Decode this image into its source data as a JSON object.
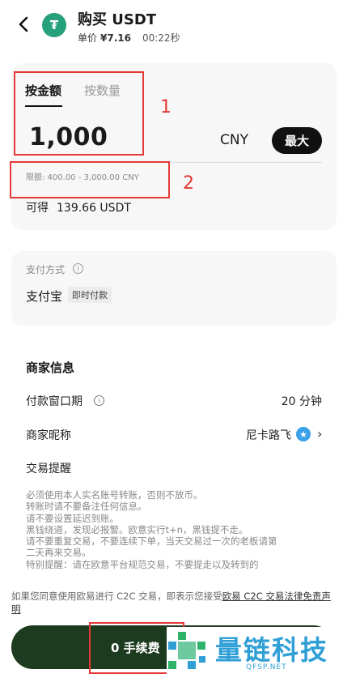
{
  "header": {
    "title": "购买 USDT",
    "coin_symbol": "₮",
    "price_label": "单价",
    "price_value": "¥7.16",
    "timer": "00:22秒"
  },
  "amount_card": {
    "tabs": [
      {
        "label": "按金额",
        "active": true
      },
      {
        "label": "按数量",
        "active": false
      }
    ],
    "amount": "1,000",
    "currency": "CNY",
    "max_label": "最大",
    "limit": "限额: 400.00 - 3,000.00 CNY",
    "receive_label": "可得",
    "receive_value": "139.66 USDT"
  },
  "annotations": {
    "n1": "1",
    "n2": "2"
  },
  "payment": {
    "label": "支付方式",
    "method": "支付宝",
    "tag": "即时付款"
  },
  "merchant": {
    "title": "商家信息",
    "window_label": "付款窗口期",
    "window_value": "20 分钟",
    "nickname_label": "商家昵称",
    "nickname_value": "尼卡路飞",
    "tips_title": "交易提醒",
    "tips_lines": [
      "必须使用本人实名账号转账，否则不放币。",
      "转账时请不要备注任何信息。",
      "请不要设置延迟到账。",
      "黑钱绕道，发现必报警。欧意实行t+n，黑钱提不走。",
      "请不要重复交易，不要连续下单，当天交易过一次的老板请第",
      "二天再来交易。",
      "特别提醒：请在欧意平台规范交易，不要提走以及转到的"
    ]
  },
  "consent": {
    "text": "如果您同意使用欧易进行 C2C 交易，即表示您接受",
    "link": "欧易 C2C 交易法律免责声明"
  },
  "buy_button": {
    "label": "0 手续费"
  },
  "watermark": {
    "text": "量链科技",
    "sub": "QFSP.NET"
  },
  "colors": {
    "accent_dark": "#1d3b1f",
    "tether_green": "#26a17b",
    "annotation_red": "#e53935"
  },
  "icons": [
    "back-arrow-icon",
    "tether-icon",
    "info-icon",
    "verified-badge-icon",
    "chevron-right-icon"
  ]
}
